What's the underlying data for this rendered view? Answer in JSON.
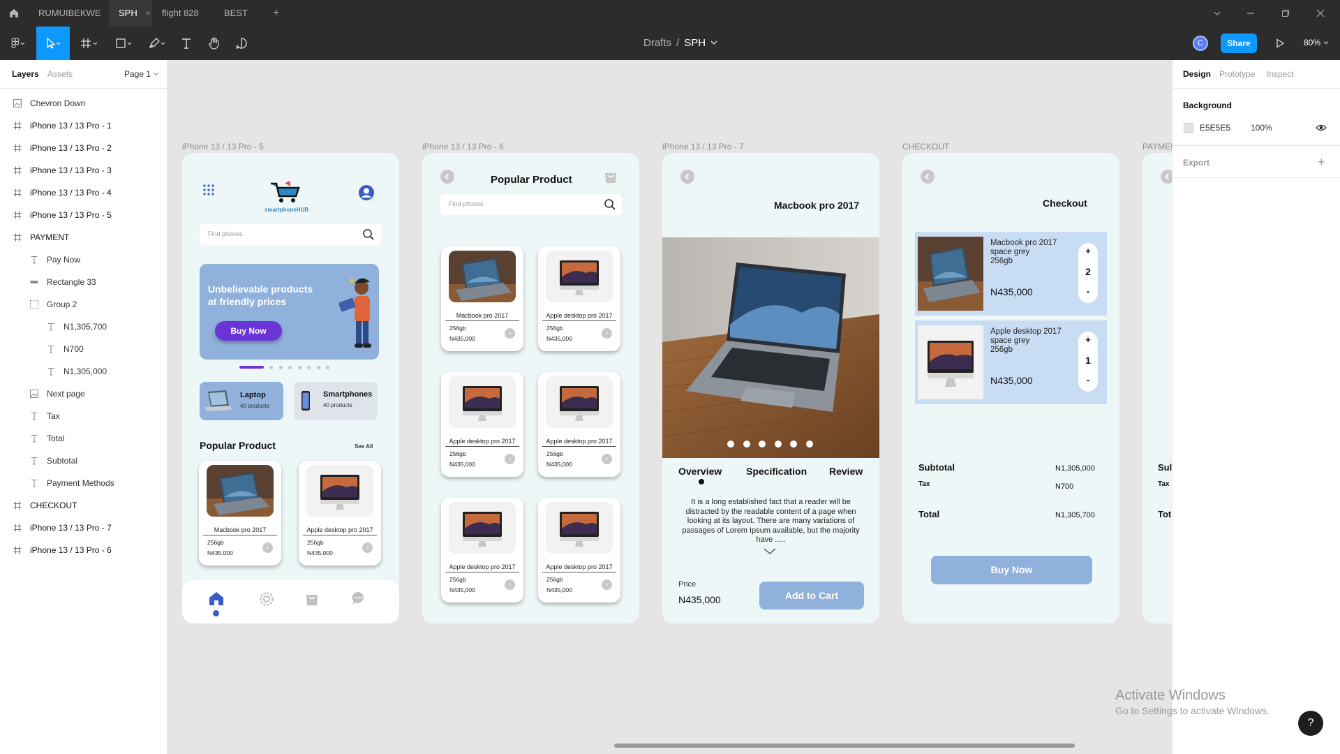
{
  "app": {
    "tabs": [
      "RUMUIBEKWE",
      "SPH",
      "flight 828",
      "BEST"
    ],
    "active_tab_close": "×",
    "new_tab": "+",
    "breadcrumb": {
      "parent": "Drafts",
      "separator": "/",
      "current": "SPH"
    },
    "user_initial": "C",
    "share_label": "Share",
    "zoom": "80%"
  },
  "left_panel": {
    "tabs": [
      "Layers",
      "Assets"
    ],
    "page_selector": "Page 1",
    "layers": [
      {
        "label": "Chevron Down",
        "icon": "image-icon",
        "level": 0,
        "bold": false
      },
      {
        "label": "iPhone 13 / 13 Pro - 1",
        "icon": "frame-icon",
        "level": 0,
        "bold": true
      },
      {
        "label": "iPhone 13 / 13 Pro - 2",
        "icon": "frame-icon",
        "level": 0,
        "bold": true
      },
      {
        "label": "iPhone 13 / 13 Pro - 3",
        "icon": "frame-icon",
        "level": 0,
        "bold": true
      },
      {
        "label": "iPhone 13 / 13 Pro - 4",
        "icon": "frame-icon",
        "level": 0,
        "bold": true
      },
      {
        "label": "iPhone 13 / 13 Pro - 5",
        "icon": "frame-icon",
        "level": 0,
        "bold": true
      },
      {
        "label": "PAYMENT",
        "icon": "frame-icon",
        "level": 0,
        "bold": true
      },
      {
        "label": "Pay Now",
        "icon": "text-icon",
        "level": 1,
        "bold": false
      },
      {
        "label": "Rectangle 33",
        "icon": "rectangle-icon",
        "level": 1,
        "bold": false
      },
      {
        "label": "Group 2",
        "icon": "group-icon",
        "level": 1,
        "bold": false
      },
      {
        "label": "N1,305,700",
        "icon": "text-icon",
        "level": 2,
        "bold": false
      },
      {
        "label": "N700",
        "icon": "text-icon",
        "level": 2,
        "bold": false
      },
      {
        "label": "N1,305,000",
        "icon": "text-icon",
        "level": 2,
        "bold": false
      },
      {
        "label": "Next page",
        "icon": "image-icon",
        "level": 1,
        "bold": false
      },
      {
        "label": "Tax",
        "icon": "text-icon",
        "level": 1,
        "bold": false
      },
      {
        "label": "Total",
        "icon": "text-icon",
        "level": 1,
        "bold": false
      },
      {
        "label": "Subtotal",
        "icon": "text-icon",
        "level": 1,
        "bold": false
      },
      {
        "label": "Payment Methods",
        "icon": "text-icon",
        "level": 1,
        "bold": false
      },
      {
        "label": "CHECKOUT",
        "icon": "frame-icon",
        "level": 0,
        "bold": true
      },
      {
        "label": "iPhone 13 / 13 Pro - 7",
        "icon": "frame-icon",
        "level": 0,
        "bold": true
      },
      {
        "label": "iPhone 13 / 13 Pro - 6",
        "icon": "frame-icon",
        "level": 0,
        "bold": true
      }
    ]
  },
  "right_panel": {
    "tabs": [
      "Design",
      "Prototype",
      "Inspect"
    ],
    "background_label": "Background",
    "background_hex": "E5E5E5",
    "background_opacity": "100%",
    "export_label": "Export",
    "export_add": "+"
  },
  "canvas": {
    "frame_labels": [
      "iPhone 13 / 13 Pro - 5",
      "iPhone 13 / 13 Pro - 6",
      "iPhone 13 / 13 Pro - 7",
      "CHECKOUT",
      "PAYMENT"
    ],
    "home": {
      "logo_text": "smartphoneHUB",
      "search_placeholder": "Find phones",
      "banner_line1": "Unbelievable products",
      "banner_line2": "at friendly prices",
      "buy_now": "Buy Now",
      "categories": [
        {
          "name": "Laptop",
          "count": "40 products"
        },
        {
          "name": "Smartphones",
          "count": "40 products"
        }
      ],
      "section_title": "Popular Product",
      "see_all": "See All"
    },
    "products": [
      {
        "name": "Macbook pro 2017",
        "storage": "256gb",
        "price": "N435,000"
      },
      {
        "name": "Apple desktop pro 2017",
        "storage": "256gb",
        "price": "N435,000"
      }
    ],
    "list": {
      "title": "Popular Product",
      "search_placeholder": "Find phones"
    },
    "detail": {
      "title": "Macbook pro 2017",
      "tabs": [
        "Overview",
        "Specification",
        "Review"
      ],
      "description": "It is a long established fact that a reader will be distracted by the readable content of a page when looking at its layout. There are many variations of passages of Lorem Ipsum available, but the majority have .....",
      "price_label": "Price",
      "price": "N435,000",
      "add_to_cart": "Add to Cart"
    },
    "checkout": {
      "title": "Checkout",
      "items": [
        {
          "line1": "Macbook pro 2017",
          "line2": "space grey",
          "line3": "256gb",
          "price": "N435,000",
          "qty": "2"
        },
        {
          "line1": "Apple desktop 2017",
          "line2": "space grey",
          "line3": "256gb",
          "price": "N435,000",
          "qty": "1"
        }
      ],
      "plus": "+",
      "minus": "-",
      "subtotal_label": "Subtotal",
      "subtotal": "N1,305,000",
      "tax_label": "Tax",
      "tax": "N700",
      "total_label": "Total",
      "total": "N1,305,700",
      "buy_now": "Buy Now"
    },
    "payment_partial": {
      "sub": "Sul",
      "tax": "Tax",
      "tot": "Tot"
    }
  },
  "watermark": {
    "line1": "Activate Windows",
    "line2": "Go to Settings to activate Windows."
  },
  "help": "?",
  "colors": {
    "accent": "#0d99ff",
    "banner": "#8fb1dc",
    "buy_now_purple": "#6a35d6",
    "frame_bg": "#eef7f7",
    "canvas_bg": "#e5e5e5",
    "toolbar_bg": "#2c2c2c"
  }
}
